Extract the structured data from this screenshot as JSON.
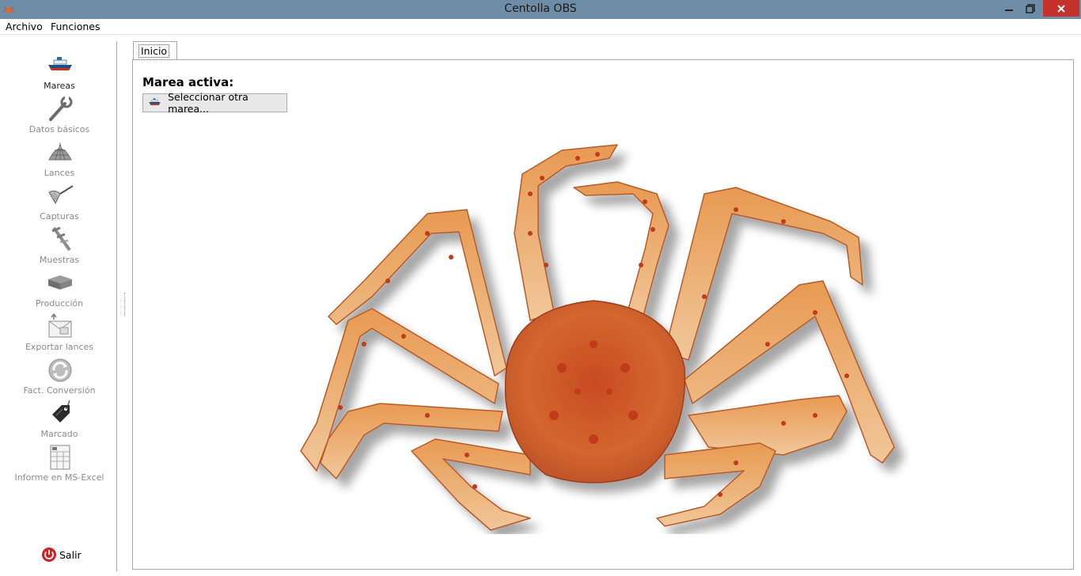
{
  "window": {
    "title": "Centolla OBS"
  },
  "menu": {
    "items": [
      "Archivo",
      "Funciones"
    ]
  },
  "sidebar": {
    "items": [
      {
        "label": "Mareas",
        "icon": "boat-icon",
        "active": true
      },
      {
        "label": "Datos básicos",
        "icon": "wrench-icon",
        "active": false
      },
      {
        "label": "Lances",
        "icon": "net-icon",
        "active": false
      },
      {
        "label": "Capturas",
        "icon": "landing-net-icon",
        "active": false
      },
      {
        "label": "Muestras",
        "icon": "caliper-icon",
        "active": false
      },
      {
        "label": "Producción",
        "icon": "box-icon",
        "active": false
      },
      {
        "label": "Exportar lances",
        "icon": "export-icon",
        "active": false
      },
      {
        "label": "Fact. Conversión",
        "icon": "refresh-icon",
        "active": false
      },
      {
        "label": "Marcado",
        "icon": "tag-icon",
        "active": false
      },
      {
        "label": "Informe en MS-Excel",
        "icon": "spreadsheet-icon",
        "active": false
      }
    ],
    "exit_label": "Salir"
  },
  "tabs": [
    {
      "label": "Inicio",
      "active": true
    }
  ],
  "main": {
    "active_trip_label": "Marea activa:",
    "select_button_label": "Seleccionar otra marea..."
  }
}
